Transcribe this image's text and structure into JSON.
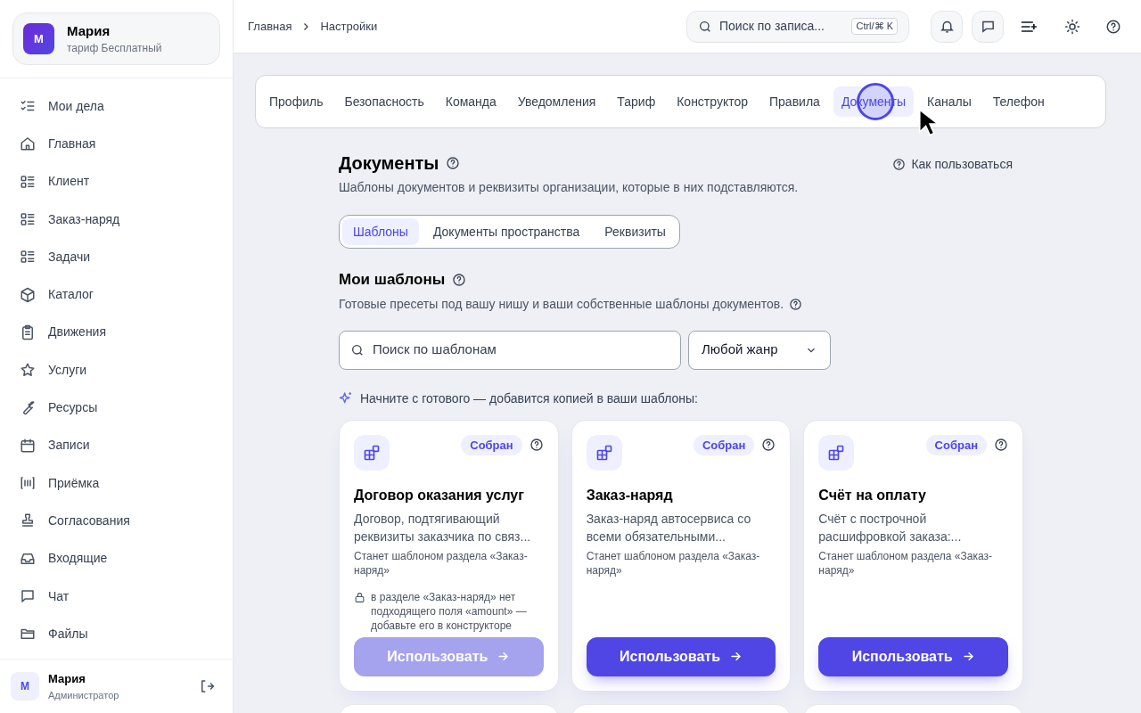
{
  "account": {
    "avatar": "М",
    "name": "Мария",
    "plan": "тариф Бесплатный"
  },
  "sidebar": {
    "items": [
      {
        "label": "Мои дела",
        "selected": false
      },
      {
        "label": "Главная",
        "selected": false
      },
      {
        "label": "Клиент",
        "selected": false
      },
      {
        "label": "Заказ-наряд",
        "selected": false
      },
      {
        "label": "Задачи",
        "selected": false
      },
      {
        "label": "Каталог",
        "selected": false
      },
      {
        "label": "Движения",
        "selected": false
      },
      {
        "label": "Услуги",
        "selected": false
      },
      {
        "label": "Ресурсы",
        "selected": false
      },
      {
        "label": "Записи",
        "selected": false
      },
      {
        "label": "Приёмка",
        "selected": false
      },
      {
        "label": "Согласования",
        "selected": false
      },
      {
        "label": "Входящие",
        "selected": false
      },
      {
        "label": "Чат",
        "selected": false
      },
      {
        "label": "Файлы",
        "selected": false
      }
    ]
  },
  "user": {
    "avatar": "М",
    "name": "Мария",
    "role": "Администратор"
  },
  "breadcrumbs": [
    "Главная",
    "Настройки"
  ],
  "search": {
    "placeholder": "Поиск по записа...",
    "shortcut": "Ctrl/⌘ K"
  },
  "tabs": [
    {
      "label": "Профиль",
      "selected": false
    },
    {
      "label": "Безопасность",
      "selected": false
    },
    {
      "label": "Команда",
      "selected": false
    },
    {
      "label": "Уведомления",
      "selected": false
    },
    {
      "label": "Тариф",
      "selected": false
    },
    {
      "label": "Конструктор",
      "selected": false
    },
    {
      "label": "Правила",
      "selected": false
    },
    {
      "label": "Документы",
      "selected": true
    },
    {
      "label": "Каналы",
      "selected": false
    },
    {
      "label": "Телефон",
      "selected": false
    }
  ],
  "page": {
    "title": "Документы",
    "subtitle": "Шаблоны документов и реквизиты организации, которые в них подставляются.",
    "help_link": "Как пользоваться"
  },
  "subtabs": [
    {
      "label": "Шаблоны",
      "selected": true
    },
    {
      "label": "Документы пространства",
      "selected": false
    },
    {
      "label": "Реквизиты",
      "selected": false
    }
  ],
  "section": {
    "title": "Мои шаблоны",
    "subtitle": "Готовые пресеты под вашу нишу и ваши собственные шаблоны документов.",
    "search_placeholder": "Поиск по шаблонам",
    "genre": "Любой жанр",
    "hint": "Начните с готового — добавится копией в ваши шаблоны:"
  },
  "cards": [
    {
      "badge": "Собран",
      "title": "Договор оказания услуг",
      "description": "Договор, подтягивающий реквизиты заказчика по связ...",
      "target": "Станет шаблоном раздела «Заказ-наряд»",
      "warning": "в разделе «Заказ-наряд» нет подходящего поля «amount» — добавьте его в конструкторе",
      "button": "Использовать",
      "disabled": true
    },
    {
      "badge": "Собран",
      "title": "Заказ-наряд",
      "description": "Заказ-наряд автосервиса со всеми обязательными...",
      "target": "Станет шаблоном раздела «Заказ-наряд»",
      "button": "Использовать",
      "disabled": false
    },
    {
      "badge": "Собран",
      "title": "Счёт на оплату",
      "description": "Счёт с построчной расшифровкой заказа:...",
      "target": "Станет шаблоном раздела «Заказ-наряд»",
      "button": "Использовать",
      "disabled": false
    }
  ]
}
